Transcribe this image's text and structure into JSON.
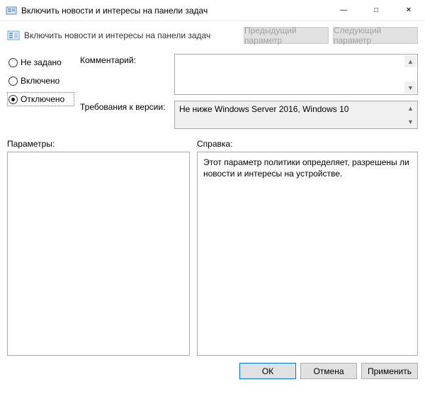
{
  "window": {
    "title": "Включить новости и интересы на панели задач"
  },
  "header": {
    "policy_title": "Включить новости и интересы на панели задач",
    "prev_btn": "Предыдущий параметр",
    "next_btn": "Следующий параметр"
  },
  "state": {
    "not_configured": "Не задано",
    "enabled": "Включено",
    "disabled": "Отключено",
    "selected": "disabled"
  },
  "labels": {
    "comment": "Комментарий:",
    "version": "Требования к версии:",
    "options": "Параметры:",
    "help": "Справка:"
  },
  "fields": {
    "comment_value": "",
    "version_value": "Не ниже Windows Server 2016, Windows 10"
  },
  "help": {
    "text": "Этот параметр политики определяет, разрешены ли новости и интересы на устройстве."
  },
  "footer": {
    "ok": "ОК",
    "cancel": "Отмена",
    "apply": "Применить"
  }
}
